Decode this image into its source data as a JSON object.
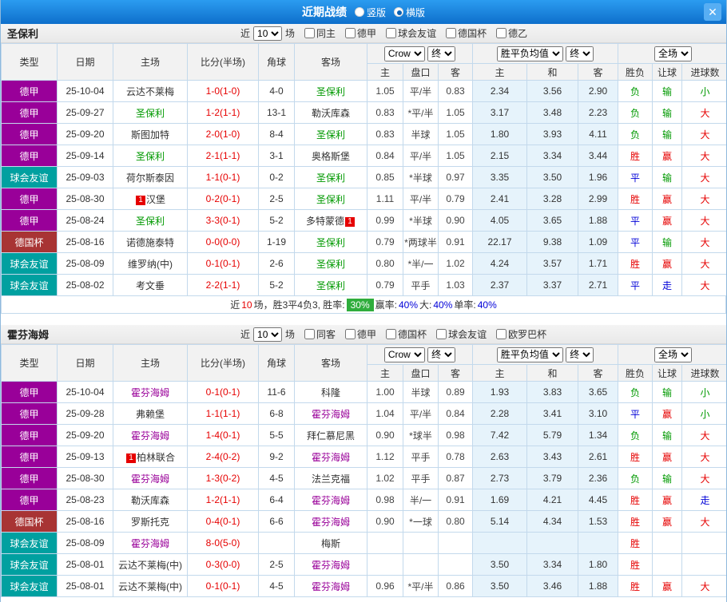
{
  "header": {
    "title": "近期战绩",
    "vertical_label": "竖版",
    "horizontal_label": "横版",
    "close_glyph": "✕"
  },
  "sections": [
    {
      "team": "圣保利",
      "filter": {
        "near": "近",
        "count": "10",
        "games": "场",
        "checkboxes": [
          "同主",
          "德甲",
          "球会友谊",
          "德国杯",
          "德乙"
        ]
      },
      "table": {
        "headers": [
          "类型",
          "日期",
          "主场",
          "比分(半场)",
          "角球",
          "客场"
        ],
        "odds_select": "Crow",
        "odds_final": "终",
        "odds_cols": [
          "主",
          "盘口",
          "客"
        ],
        "avg_select": "胜平负均值",
        "avg_final": "终",
        "avg_cols": [
          "主",
          "和",
          "客"
        ],
        "full_select": "全场",
        "full_cols": [
          "胜负",
          "让球",
          "进球数"
        ],
        "rows": [
          {
            "league": "德甲",
            "league_cls": "lg-dj",
            "date": "25-10-04",
            "home": "云达不莱梅",
            "home_cls": "",
            "home_badge": "",
            "home_badge_pos": "",
            "score": "1-0(1-0)",
            "corner": "4-0",
            "away": "圣保利",
            "away_cls": "green",
            "away_badge": "",
            "away_badge_pos": "",
            "o_home": "1.05",
            "handicap": "平/半",
            "handicap_cls": "",
            "o_away": "0.83",
            "avg_home": "2.34",
            "avg_draw": "3.56",
            "avg_away": "2.90",
            "wdl": "负",
            "wdl_cls": "green",
            "hcp": "输",
            "hcp_cls": "green",
            "ou": "小",
            "ou_cls": "green"
          },
          {
            "league": "德甲",
            "league_cls": "lg-dj",
            "date": "25-09-27",
            "home": "圣保利",
            "home_cls": "green",
            "home_badge": "",
            "home_badge_pos": "",
            "score": "1-2(1-1)",
            "corner": "13-1",
            "away": "勒沃库森",
            "away_cls": "",
            "away_badge": "",
            "away_badge_pos": "",
            "o_home": "0.83",
            "handicap": "*平/半",
            "handicap_cls": "red",
            "o_away": "1.05",
            "avg_home": "3.17",
            "avg_draw": "3.48",
            "avg_away": "2.23",
            "wdl": "负",
            "wdl_cls": "green",
            "hcp": "输",
            "hcp_cls": "green",
            "ou": "大",
            "ou_cls": "red"
          },
          {
            "league": "德甲",
            "league_cls": "lg-dj",
            "date": "25-09-20",
            "home": "斯图加特",
            "home_cls": "",
            "home_badge": "",
            "home_badge_pos": "",
            "score": "2-0(1-0)",
            "corner": "8-4",
            "away": "圣保利",
            "away_cls": "green",
            "away_badge": "",
            "away_badge_pos": "",
            "o_home": "0.83",
            "handicap": "半球",
            "handicap_cls": "",
            "o_away": "1.05",
            "avg_home": "1.80",
            "avg_draw": "3.93",
            "avg_away": "4.11",
            "wdl": "负",
            "wdl_cls": "green",
            "hcp": "输",
            "hcp_cls": "green",
            "ou": "大",
            "ou_cls": "red"
          },
          {
            "league": "德甲",
            "league_cls": "lg-dj",
            "date": "25-09-14",
            "home": "圣保利",
            "home_cls": "green",
            "home_badge": "",
            "home_badge_pos": "",
            "score": "2-1(1-1)",
            "corner": "3-1",
            "away": "奥格斯堡",
            "away_cls": "",
            "away_badge": "",
            "away_badge_pos": "",
            "o_home": "0.84",
            "handicap": "平/半",
            "handicap_cls": "",
            "o_away": "1.05",
            "avg_home": "2.15",
            "avg_draw": "3.34",
            "avg_away": "3.44",
            "wdl": "胜",
            "wdl_cls": "red",
            "hcp": "赢",
            "hcp_cls": "red",
            "ou": "大",
            "ou_cls": "red"
          },
          {
            "league": "球会友谊",
            "league_cls": "lg-fr",
            "date": "25-09-03",
            "home": "荷尔斯泰因",
            "home_cls": "",
            "home_badge": "",
            "home_badge_pos": "",
            "score": "1-1(0-1)",
            "corner": "0-2",
            "away": "圣保利",
            "away_cls": "green",
            "away_badge": "",
            "away_badge_pos": "",
            "o_home": "0.85",
            "handicap": "*半球",
            "handicap_cls": "red",
            "o_away": "0.97",
            "avg_home": "3.35",
            "avg_draw": "3.50",
            "avg_away": "1.96",
            "wdl": "平",
            "wdl_cls": "blue",
            "hcp": "输",
            "hcp_cls": "green",
            "ou": "大",
            "ou_cls": "red"
          },
          {
            "league": "德甲",
            "league_cls": "lg-dj",
            "date": "25-08-30",
            "home": "汉堡",
            "home_cls": "",
            "home_badge": "1",
            "home_badge_pos": "pre",
            "score": "0-2(0-1)",
            "corner": "2-5",
            "away": "圣保利",
            "away_cls": "green",
            "away_badge": "",
            "away_badge_pos": "",
            "o_home": "1.11",
            "handicap": "平/半",
            "handicap_cls": "",
            "o_away": "0.79",
            "avg_home": "2.41",
            "avg_draw": "3.28",
            "avg_away": "2.99",
            "wdl": "胜",
            "wdl_cls": "red",
            "hcp": "赢",
            "hcp_cls": "red",
            "ou": "大",
            "ou_cls": "red"
          },
          {
            "league": "德甲",
            "league_cls": "lg-dj",
            "date": "25-08-24",
            "home": "圣保利",
            "home_cls": "green",
            "home_badge": "",
            "home_badge_pos": "",
            "score": "3-3(0-1)",
            "corner": "5-2",
            "away": "多特蒙德",
            "away_cls": "",
            "away_badge": "1",
            "away_badge_pos": "post",
            "o_home": "0.99",
            "handicap": "*半球",
            "handicap_cls": "red",
            "o_away": "0.90",
            "avg_home": "4.05",
            "avg_draw": "3.65",
            "avg_away": "1.88",
            "wdl": "平",
            "wdl_cls": "blue",
            "hcp": "赢",
            "hcp_cls": "red",
            "ou": "大",
            "ou_cls": "red"
          },
          {
            "league": "德国杯",
            "league_cls": "lg-cup",
            "date": "25-08-16",
            "home": "诺德施泰特",
            "home_cls": "",
            "home_badge": "",
            "home_badge_pos": "",
            "score": "0-0(0-0)",
            "corner": "1-19",
            "away": "圣保利",
            "away_cls": "green",
            "away_badge": "",
            "away_badge_pos": "",
            "o_home": "0.79",
            "handicap": "*两球半",
            "handicap_cls": "red",
            "o_away": "0.91",
            "avg_home": "22.17",
            "avg_draw": "9.38",
            "avg_away": "1.09",
            "wdl": "平",
            "wdl_cls": "blue",
            "hcp": "输",
            "hcp_cls": "green",
            "ou": "大",
            "ou_cls": "red"
          },
          {
            "league": "球会友谊",
            "league_cls": "lg-fr",
            "date": "25-08-09",
            "home": "维罗纳(中)",
            "home_cls": "",
            "home_badge": "",
            "home_badge_pos": "",
            "score": "0-1(0-1)",
            "corner": "2-6",
            "away": "圣保利",
            "away_cls": "green",
            "away_badge": "",
            "away_badge_pos": "",
            "o_home": "0.80",
            "handicap": "*半/一",
            "handicap_cls": "red",
            "o_away": "1.02",
            "avg_home": "4.24",
            "avg_draw": "3.57",
            "avg_away": "1.71",
            "wdl": "胜",
            "wdl_cls": "red",
            "hcp": "赢",
            "hcp_cls": "red",
            "ou": "大",
            "ou_cls": "red"
          },
          {
            "league": "球会友谊",
            "league_cls": "lg-fr",
            "date": "25-08-02",
            "home": "考文垂",
            "home_cls": "",
            "home_badge": "",
            "home_badge_pos": "",
            "score": "2-2(1-1)",
            "corner": "5-2",
            "away": "圣保利",
            "away_cls": "green",
            "away_badge": "",
            "away_badge_pos": "",
            "o_home": "0.79",
            "handicap": "平手",
            "handicap_cls": "",
            "o_away": "1.03",
            "avg_home": "2.37",
            "avg_draw": "3.37",
            "avg_away": "2.71",
            "wdl": "平",
            "wdl_cls": "blue",
            "hcp": "走",
            "hcp_cls": "blue",
            "ou": "大",
            "ou_cls": "red"
          }
        ]
      },
      "summary": {
        "part1": "近",
        "count": "10",
        "part2": "场，胜3平4负3, 胜率:",
        "rate": "30%",
        "stats": [
          {
            "label": "赢率:",
            "value": "40%"
          },
          {
            "label": "大:",
            "value": "40%"
          },
          {
            "label": "单率:",
            "value": "40%"
          }
        ]
      }
    },
    {
      "team": "霍芬海姆",
      "filter": {
        "near": "近",
        "count": "10",
        "games": "场",
        "checkboxes": [
          "同客",
          "德甲",
          "德国杯",
          "球会友谊",
          "欧罗巴杯"
        ]
      },
      "table": {
        "headers": [
          "类型",
          "日期",
          "主场",
          "比分(半场)",
          "角球",
          "客场"
        ],
        "odds_select": "Crow",
        "odds_final": "终",
        "odds_cols": [
          "主",
          "盘口",
          "客"
        ],
        "avg_select": "胜平负均值",
        "avg_final": "终",
        "avg_cols": [
          "主",
          "和",
          "客"
        ],
        "full_select": "全场",
        "full_cols": [
          "胜负",
          "让球",
          "进球数"
        ],
        "rows": [
          {
            "league": "德甲",
            "league_cls": "lg-dj",
            "date": "25-10-04",
            "home": "霍芬海姆",
            "home_cls": "purple",
            "home_badge": "",
            "home_badge_pos": "",
            "score": "0-1(0-1)",
            "corner": "11-6",
            "away": "科隆",
            "away_cls": "",
            "away_badge": "",
            "away_badge_pos": "",
            "o_home": "1.00",
            "handicap": "半球",
            "handicap_cls": "",
            "o_away": "0.89",
            "avg_home": "1.93",
            "avg_draw": "3.83",
            "avg_away": "3.65",
            "wdl": "负",
            "wdl_cls": "green",
            "hcp": "输",
            "hcp_cls": "green",
            "ou": "小",
            "ou_cls": "green"
          },
          {
            "league": "德甲",
            "league_cls": "lg-dj",
            "date": "25-09-28",
            "home": "弗赖堡",
            "home_cls": "",
            "home_badge": "",
            "home_badge_pos": "",
            "score": "1-1(1-1)",
            "corner": "6-8",
            "away": "霍芬海姆",
            "away_cls": "purple",
            "away_badge": "",
            "away_badge_pos": "",
            "o_home": "1.04",
            "handicap": "平/半",
            "handicap_cls": "",
            "o_away": "0.84",
            "avg_home": "2.28",
            "avg_draw": "3.41",
            "avg_away": "3.10",
            "wdl": "平",
            "wdl_cls": "blue",
            "hcp": "赢",
            "hcp_cls": "red",
            "ou": "小",
            "ou_cls": "green"
          },
          {
            "league": "德甲",
            "league_cls": "lg-dj",
            "date": "25-09-20",
            "home": "霍芬海姆",
            "home_cls": "purple",
            "home_badge": "",
            "home_badge_pos": "",
            "score": "1-4(0-1)",
            "corner": "5-5",
            "away": "拜仁慕尼黑",
            "away_cls": "",
            "away_badge": "",
            "away_badge_pos": "",
            "o_home": "0.90",
            "handicap": "*球半",
            "handicap_cls": "red",
            "o_away": "0.98",
            "avg_home": "7.42",
            "avg_draw": "5.79",
            "avg_away": "1.34",
            "wdl": "负",
            "wdl_cls": "green",
            "hcp": "输",
            "hcp_cls": "green",
            "ou": "大",
            "ou_cls": "red"
          },
          {
            "league": "德甲",
            "league_cls": "lg-dj",
            "date": "25-09-13",
            "home": "柏林联合",
            "home_cls": "",
            "home_badge": "1",
            "home_badge_pos": "pre",
            "score": "2-4(0-2)",
            "corner": "9-2",
            "away": "霍芬海姆",
            "away_cls": "purple",
            "away_badge": "",
            "away_badge_pos": "",
            "o_home": "1.12",
            "handicap": "平手",
            "handicap_cls": "",
            "o_away": "0.78",
            "avg_home": "2.63",
            "avg_draw": "3.43",
            "avg_away": "2.61",
            "wdl": "胜",
            "wdl_cls": "red",
            "hcp": "赢",
            "hcp_cls": "red",
            "ou": "大",
            "ou_cls": "red"
          },
          {
            "league": "德甲",
            "league_cls": "lg-dj",
            "date": "25-08-30",
            "home": "霍芬海姆",
            "home_cls": "purple",
            "home_badge": "",
            "home_badge_pos": "",
            "score": "1-3(0-2)",
            "corner": "4-5",
            "away": "法兰克福",
            "away_cls": "",
            "away_badge": "",
            "away_badge_pos": "",
            "o_home": "1.02",
            "handicap": "平手",
            "handicap_cls": "",
            "o_away": "0.87",
            "avg_home": "2.73",
            "avg_draw": "3.79",
            "avg_away": "2.36",
            "wdl": "负",
            "wdl_cls": "green",
            "hcp": "输",
            "hcp_cls": "green",
            "ou": "大",
            "ou_cls": "red"
          },
          {
            "league": "德甲",
            "league_cls": "lg-dj",
            "date": "25-08-23",
            "home": "勒沃库森",
            "home_cls": "",
            "home_badge": "",
            "home_badge_pos": "",
            "score": "1-2(1-1)",
            "corner": "6-4",
            "away": "霍芬海姆",
            "away_cls": "purple",
            "away_badge": "",
            "away_badge_pos": "",
            "o_home": "0.98",
            "handicap": "半/一",
            "handicap_cls": "",
            "o_away": "0.91",
            "avg_home": "1.69",
            "avg_draw": "4.21",
            "avg_away": "4.45",
            "wdl": "胜",
            "wdl_cls": "red",
            "hcp": "赢",
            "hcp_cls": "red",
            "ou": "走",
            "ou_cls": "blue"
          },
          {
            "league": "德国杯",
            "league_cls": "lg-cup",
            "date": "25-08-16",
            "home": "罗斯托克",
            "home_cls": "",
            "home_badge": "",
            "home_badge_pos": "",
            "score": "0-4(0-1)",
            "corner": "6-6",
            "away": "霍芬海姆",
            "away_cls": "purple",
            "away_badge": "",
            "away_badge_pos": "",
            "o_home": "0.90",
            "handicap": "*一球",
            "handicap_cls": "red",
            "o_away": "0.80",
            "avg_home": "5.14",
            "avg_draw": "4.34",
            "avg_away": "1.53",
            "wdl": "胜",
            "wdl_cls": "red",
            "hcp": "赢",
            "hcp_cls": "red",
            "ou": "大",
            "ou_cls": "red"
          },
          {
            "league": "球会友谊",
            "league_cls": "lg-fr",
            "date": "25-08-09",
            "home": "霍芬海姆",
            "home_cls": "purple",
            "home_badge": "",
            "home_badge_pos": "",
            "score": "8-0(5-0)",
            "corner": "",
            "away": "梅斯",
            "away_cls": "",
            "away_badge": "",
            "away_badge_pos": "",
            "o_home": "",
            "handicap": "",
            "handicap_cls": "",
            "o_away": "",
            "avg_home": "",
            "avg_draw": "",
            "avg_away": "",
            "wdl": "胜",
            "wdl_cls": "red",
            "hcp": "",
            "hcp_cls": "",
            "ou": "",
            "ou_cls": ""
          },
          {
            "league": "球会友谊",
            "league_cls": "lg-fr",
            "date": "25-08-01",
            "home": "云达不莱梅(中)",
            "home_cls": "",
            "home_badge": "",
            "home_badge_pos": "",
            "score": "0-3(0-0)",
            "corner": "2-5",
            "away": "霍芬海姆",
            "away_cls": "purple",
            "away_badge": "",
            "away_badge_pos": "",
            "o_home": "",
            "handicap": "",
            "handicap_cls": "",
            "o_away": "",
            "avg_home": "3.50",
            "avg_draw": "3.34",
            "avg_away": "1.80",
            "wdl": "胜",
            "wdl_cls": "red",
            "hcp": "",
            "hcp_cls": "",
            "ou": "",
            "ou_cls": ""
          },
          {
            "league": "球会友谊",
            "league_cls": "lg-fr",
            "date": "25-08-01",
            "home": "云达不莱梅(中)",
            "home_cls": "",
            "home_badge": "",
            "home_badge_pos": "",
            "score": "0-1(0-1)",
            "corner": "4-5",
            "away": "霍芬海姆",
            "away_cls": "purple",
            "away_badge": "",
            "away_badge_pos": "",
            "o_home": "0.96",
            "handicap": "*平/半",
            "handicap_cls": "red",
            "o_away": "0.86",
            "avg_home": "3.50",
            "avg_draw": "3.46",
            "avg_away": "1.88",
            "wdl": "胜",
            "wdl_cls": "red",
            "hcp": "赢",
            "hcp_cls": "red",
            "ou": "大",
            "ou_cls": "red"
          }
        ]
      }
    }
  ]
}
